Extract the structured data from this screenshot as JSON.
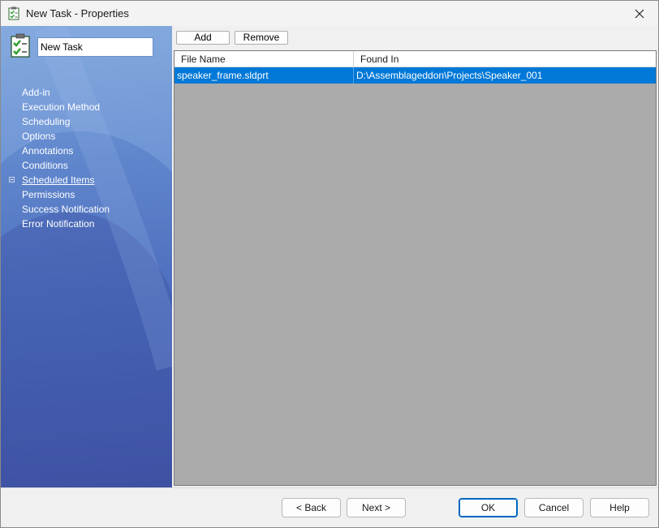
{
  "window": {
    "title": "New Task - Properties"
  },
  "sidebar": {
    "task_name_value": "New Task",
    "items": [
      {
        "label": "Add-in"
      },
      {
        "label": "Execution Method"
      },
      {
        "label": "Scheduling"
      },
      {
        "label": "Options"
      },
      {
        "label": "Annotations"
      },
      {
        "label": "Conditions"
      },
      {
        "label": "Scheduled Items",
        "active": true,
        "expandable": true
      },
      {
        "label": "Permissions"
      },
      {
        "label": "Success Notification"
      },
      {
        "label": "Error Notification"
      }
    ]
  },
  "toolbar": {
    "add_label": "Add",
    "remove_label": "Remove"
  },
  "grid": {
    "columns": [
      "File Name",
      "Found In"
    ],
    "rows": [
      {
        "file_name": "speaker_frame.sldprt",
        "found_in": "D:\\Assemblageddon\\Projects\\Speaker_001",
        "selected": true
      }
    ]
  },
  "footer": {
    "back_label": "< Back",
    "next_label": "Next >",
    "ok_label": "OK",
    "cancel_label": "Cancel",
    "help_label": "Help"
  },
  "colors": {
    "selection": "#0078d7",
    "sidebar_top": "#7ea6dc",
    "sidebar_bottom": "#4154a6",
    "grid_background": "#ababab",
    "default_button_border": "#0067c0"
  },
  "icons": {
    "app": "task-checklist-icon",
    "close": "close-icon",
    "task": "task-checklist-icon",
    "expander": "expand-plus-icon"
  }
}
